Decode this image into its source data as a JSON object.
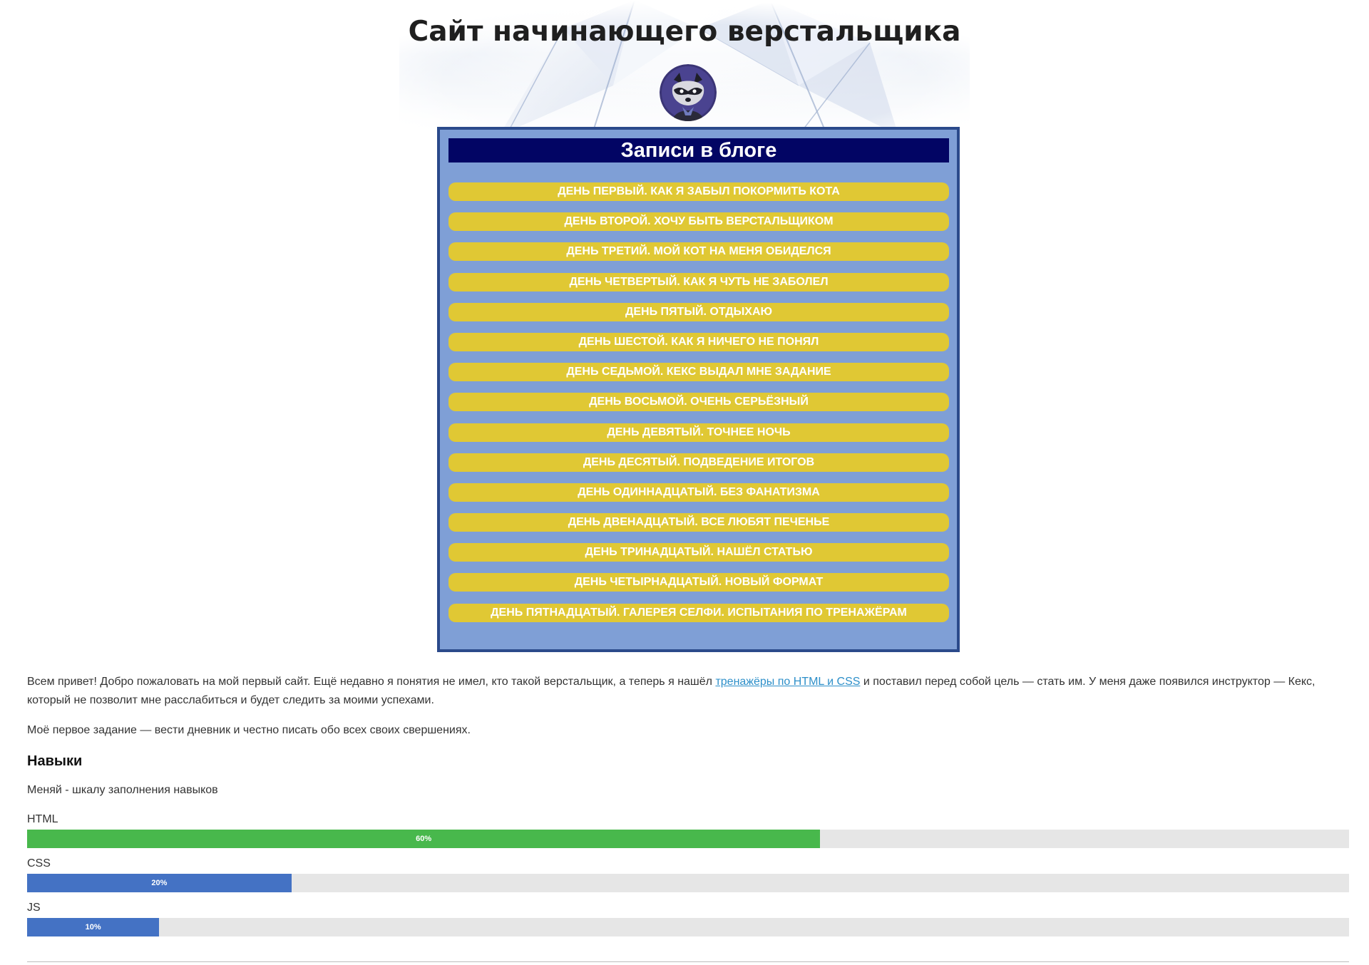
{
  "header": {
    "title": "Сайт начинающего верстальщика",
    "avatar_icon": "raccoon-avatar-icon"
  },
  "blog": {
    "title": "Записи в блоге",
    "posts": [
      "ДЕНЬ ПЕРВЫЙ. КАК Я ЗАБЫЛ ПОКОРМИТЬ КОТА",
      "ДЕНЬ ВТОРОЙ. ХОЧУ БЫТЬ ВЕРСТАЛЬЩИКОМ",
      "ДЕНЬ ТРЕТИЙ. МОЙ КОТ НА МЕНЯ ОБИДЕЛСЯ",
      "ДЕНЬ ЧЕТВЕРТЫЙ. КАК Я ЧУТЬ НЕ ЗАБОЛЕЛ",
      "ДЕНЬ ПЯТЫЙ. ОТДЫХАЮ",
      "ДЕНЬ ШЕСТОЙ. КАК Я НИЧЕГО НЕ ПОНЯЛ",
      "ДЕНЬ СЕДЬМОЙ. КЕКС ВЫДАЛ МНЕ ЗАДАНИЕ",
      "ДЕНЬ ВОСЬМОЙ. ОЧЕНЬ СЕРЬЁЗНЫЙ",
      "ДЕНЬ ДЕВЯТЫЙ. ТОЧНЕЕ НОЧЬ",
      "ДЕНЬ ДЕСЯТЫЙ. ПОДВЕДЕНИЕ ИТОГОВ",
      "ДЕНЬ ОДИННАДЦАТЫЙ. БЕЗ ФАНАТИЗМА",
      "ДЕНЬ ДВЕНАДЦАТЫЙ. ВСЕ ЛЮБЯТ ПЕЧЕНЬЕ",
      "ДЕНЬ ТРИНАДЦАТЫЙ. НАШЁЛ СТАТЬЮ",
      "ДЕНЬ ЧЕТЫРНАДЦАТЫЙ. НОВЫЙ ФОРМАТ",
      "ДЕНЬ ПЯТНАДЦАТЫЙ. ГАЛЕРЕЯ СЕЛФИ. ИСПЫТАНИЯ ПО ТРЕНАЖЁРАМ"
    ]
  },
  "intro": {
    "before_link": "Всем привет! Добро пожаловать на мой первый сайт. Ещё недавно я понятия не имел, кто такой верстальщик, а теперь я нашёл ",
    "link_text": "тренажёры по HTML и CSS",
    "after_link": " и поставил перед собой цель — стать им. У меня даже появился инструктор — Кекс, который не позволит мне расслабиться и будет следить за моими успехами."
  },
  "task": "Моё первое задание — вести дневник и честно писать обо всех своих свершениях.",
  "skills": {
    "heading": "Навыки",
    "note": "Меняй - шкалу заполнения навыков",
    "items": [
      {
        "name": "HTML",
        "value": 60,
        "label": "60%",
        "color": "#48b84c"
      },
      {
        "name": "CSS",
        "value": 20,
        "label": "20%",
        "color": "#4472c4"
      },
      {
        "name": "JS",
        "value": 10,
        "label": "10%",
        "color": "#4472c4"
      }
    ]
  },
  "colors": {
    "blog_bg": "#7f9fd6",
    "blog_border": "#2b4a8b",
    "blog_title_bg": "#020564",
    "post_bg": "#e0c834",
    "link": "#2d8fc9",
    "track": "#e6e6e6"
  }
}
